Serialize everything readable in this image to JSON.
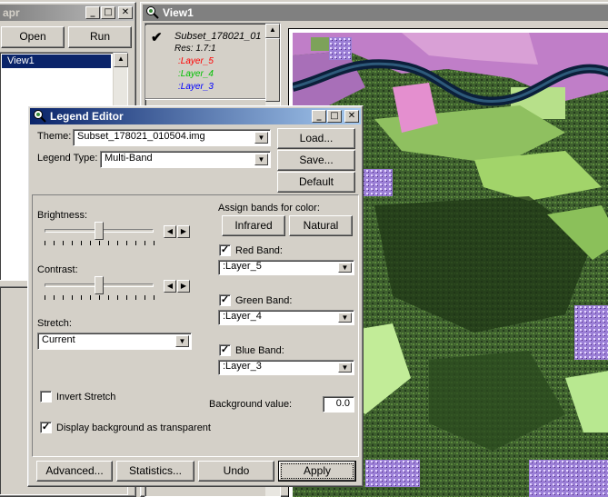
{
  "left_window": {
    "title": "apr",
    "open_label": "Open",
    "run_label": "Run",
    "list_item": "View1"
  },
  "view_window": {
    "title": "View1",
    "toc": {
      "theme_name": "Subset_178021_01",
      "res": "Res: 1.7:1",
      "layers": [
        {
          "label": ":Layer_5",
          "color": "#ff0000"
        },
        {
          "label": ":Layer_4",
          "color": "#00c000"
        },
        {
          "label": ":Layer_3",
          "color": "#0000ff"
        }
      ]
    }
  },
  "legend_editor": {
    "title": "Legend Editor",
    "theme_label": "Theme:",
    "theme_value": "Subset_178021_010504.img",
    "legend_type_label": "Legend Type:",
    "legend_type_value": "Multi-Band",
    "load_label": "Load...",
    "save_label": "Save...",
    "default_label": "Default",
    "brightness_label": "Brightness:",
    "brightness_level": 0.5,
    "contrast_label": "Contrast:",
    "contrast_level": 0.5,
    "stretch_label": "Stretch:",
    "stretch_value": "Current",
    "assign_label": "Assign bands for color:",
    "infrared_label": "Infrared",
    "natural_label": "Natural",
    "red_band_label": "Red Band:",
    "red_band_value": ":Layer_5",
    "green_band_label": "Green Band:",
    "green_band_value": ":Layer_4",
    "blue_band_label": "Blue Band:",
    "blue_band_value": ":Layer_3",
    "invert_stretch_label": "Invert Stretch",
    "bg_value_label": "Background value:",
    "bg_value": "0.0",
    "display_bg_label": "Display background as transparent",
    "advanced_label": "Advanced...",
    "statistics_label": "Statistics...",
    "undo_label": "Undo",
    "apply_label": "Apply"
  }
}
